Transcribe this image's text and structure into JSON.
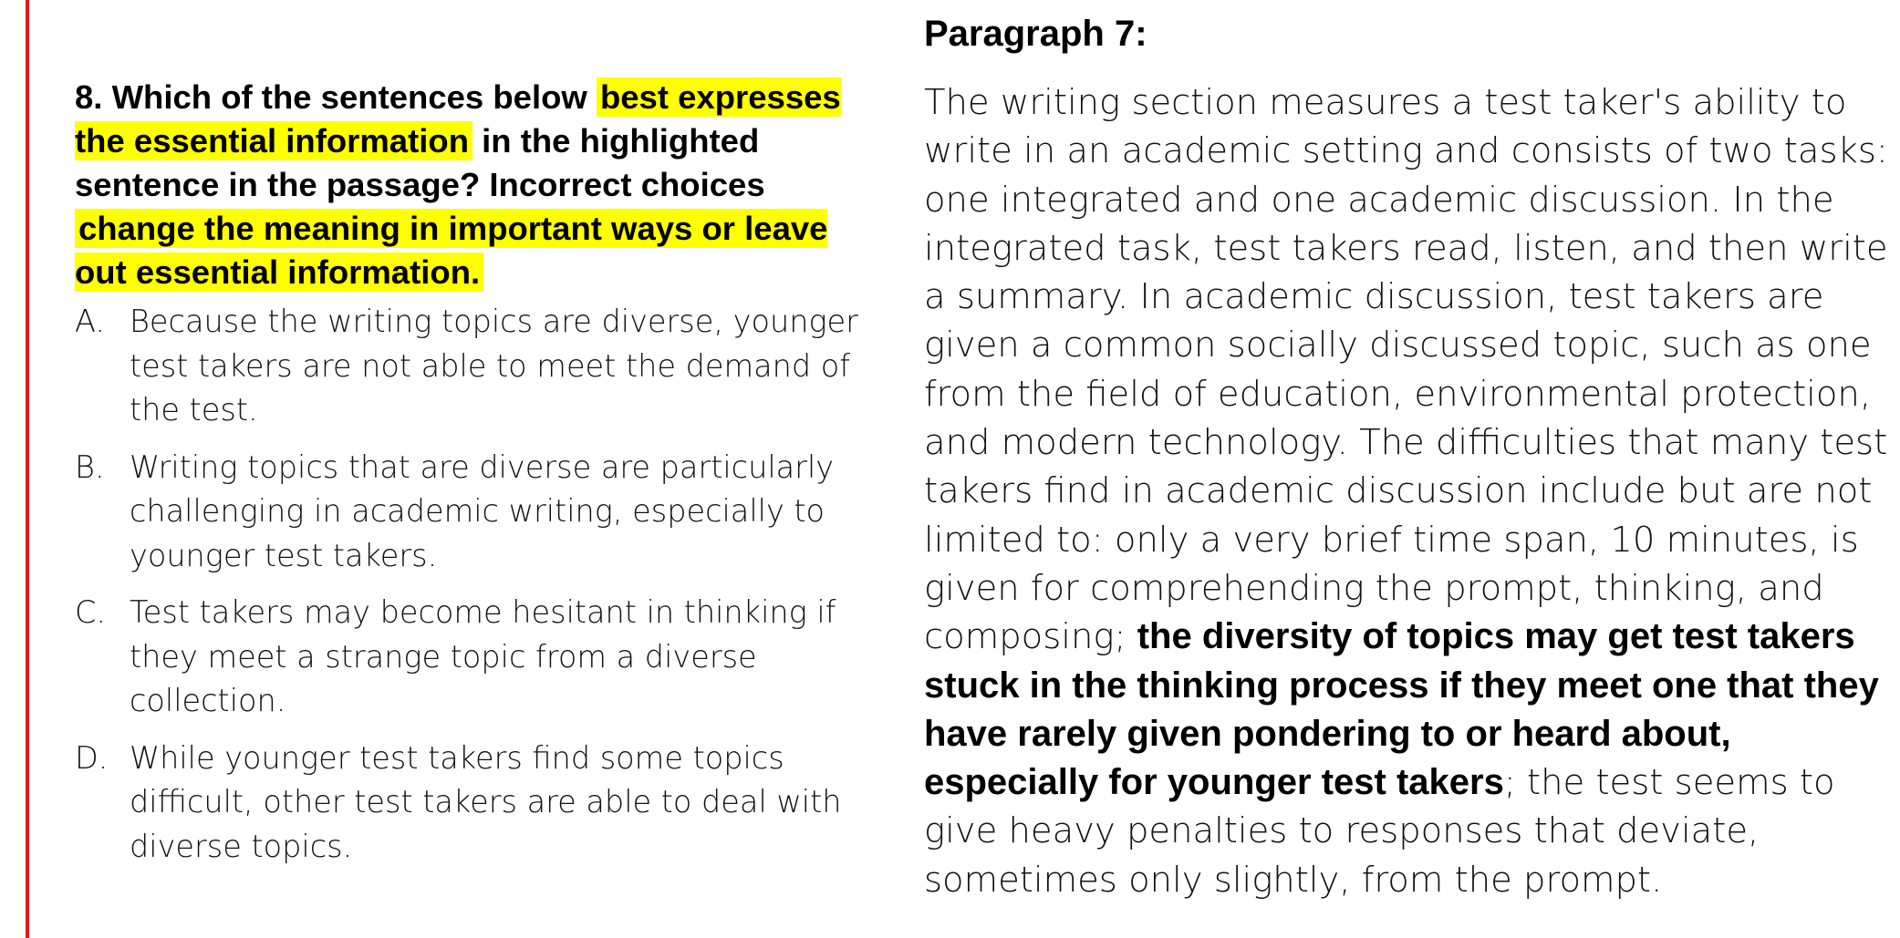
{
  "colors": {
    "rule": "#e8161d",
    "highlight": "#ffff00"
  },
  "question": {
    "number_prefix": "8. Which of the sentences below ",
    "highlight_1": "best expresses the essential information",
    "middle": " in the highlighted sentence in the passage? Incorrect choices ",
    "highlight_2": "change the meaning in important ways or leave out essential information.",
    "options": [
      {
        "letter": "A.",
        "text": "Because the writing topics are diverse, younger test takers are not able to meet the demand of the test."
      },
      {
        "letter": "B.",
        "text": "Writing topics that are diverse are particularly challenging in academic writing, especially to younger test takers."
      },
      {
        "letter": "C.",
        "text": "Test takers may become hesitant in thinking if they meet a strange topic from a diverse collection."
      },
      {
        "letter": "D.",
        "text": "While younger test takers find some topics difficult, other test takers are able to deal with diverse topics."
      }
    ]
  },
  "passage": {
    "title": "Paragraph 7:",
    "text_before": "The writing section measures a test taker's ability to write in an academic setting and consists of two tasks: one integrated and one academic discussion. In the integrated task, test takers read, listen, and then write a summary. In academic discussion, test takers are given a common socially discussed topic, such as one from the field of education, environmental protection, and modern technology. The difficulties that many test takers find in academic discussion include but are not limited to: only a very brief time span, 10 minutes, is given for comprehending the prompt, thinking, and composing; ",
    "text_bold": "the diversity of topics may get test takers stuck in the thinking process if they meet one that they have rarely given pondering to or heard about, especially for younger test takers",
    "text_after": "; the test seems to give heavy penalties to responses that deviate, sometimes only slightly, from the prompt."
  }
}
